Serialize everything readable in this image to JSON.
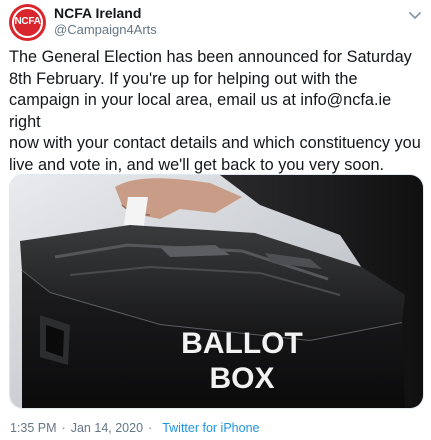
{
  "tweet": {
    "avatar_text": "NCFA",
    "display_name": "NCFA Ireland",
    "handle": "@Campaign4Arts",
    "text": "The General Election has been announced for Saturday\n8th February. If you're up for helping out with the\ncampaign in your local area, email us at info@ncfa.ie right\nnow with your contact details and which constituency you\nlive and vote in, and we'll get back to you very soon.",
    "image": {
      "label_line1": "BALLOT",
      "label_line2": "BOX"
    },
    "time": "1:35 PM",
    "date": "Jan 14, 2020",
    "separator": "·",
    "source": "Twitter for iPhone"
  },
  "colors": {
    "avatar_red": "#d8262c",
    "link_blue": "#1b95e0",
    "secondary_gray": "#657786"
  },
  "icons": {
    "menu": "chevron-down-icon"
  }
}
